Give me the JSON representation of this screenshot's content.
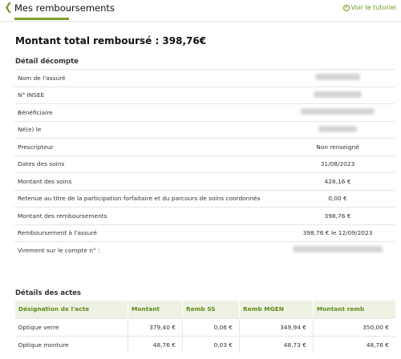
{
  "header": {
    "title": "Mes remboursements",
    "tutorial_label": "Voir le tutoriel"
  },
  "total_label": "Montant total remboursé : 398,76€",
  "detail": {
    "title": "Détail décompte",
    "rows": [
      {
        "label": "Nom de l'assuré",
        "value": "",
        "redacted": true
      },
      {
        "label": "N° INSEE",
        "value": "",
        "redacted": true
      },
      {
        "label": "Bénéficiaire",
        "value": "",
        "redacted": true
      },
      {
        "label": "Né(e) le",
        "value": "",
        "redacted": true
      },
      {
        "label": "Prescripteur",
        "value": "Non renseigné"
      },
      {
        "label": "Dates des soins",
        "value": "31/08/2023"
      },
      {
        "label": "Montant des soins",
        "value": "428,16 €"
      },
      {
        "label": "Retenue au titre de la participation forfaitaire et du parcours de soins coordonnés",
        "value": "0,00 €"
      },
      {
        "label": "Montant des remboursements",
        "value": "398,76 €"
      },
      {
        "label": "Remboursement à l'assuré",
        "value": "398,76 € le 12/09/2023"
      },
      {
        "label": "Virement sur le compte n° :",
        "value": "",
        "redacted": true
      }
    ]
  },
  "acts": {
    "title": "Détails des actes",
    "columns": [
      "Désignation de l'acte",
      "Montant",
      "Remb SS",
      "Remb MGEN",
      "Montant remb"
    ],
    "rows": [
      [
        "Optique verre",
        "379,40  €",
        "0,06  €",
        "349,94  €",
        "350,00  €"
      ],
      [
        "Optique monture",
        "48,76  €",
        "0,03  €",
        "48,73  €",
        "48,76  €"
      ]
    ]
  },
  "colors": {
    "accent": "#7aa028",
    "header_bg": "#eef2e3"
  }
}
